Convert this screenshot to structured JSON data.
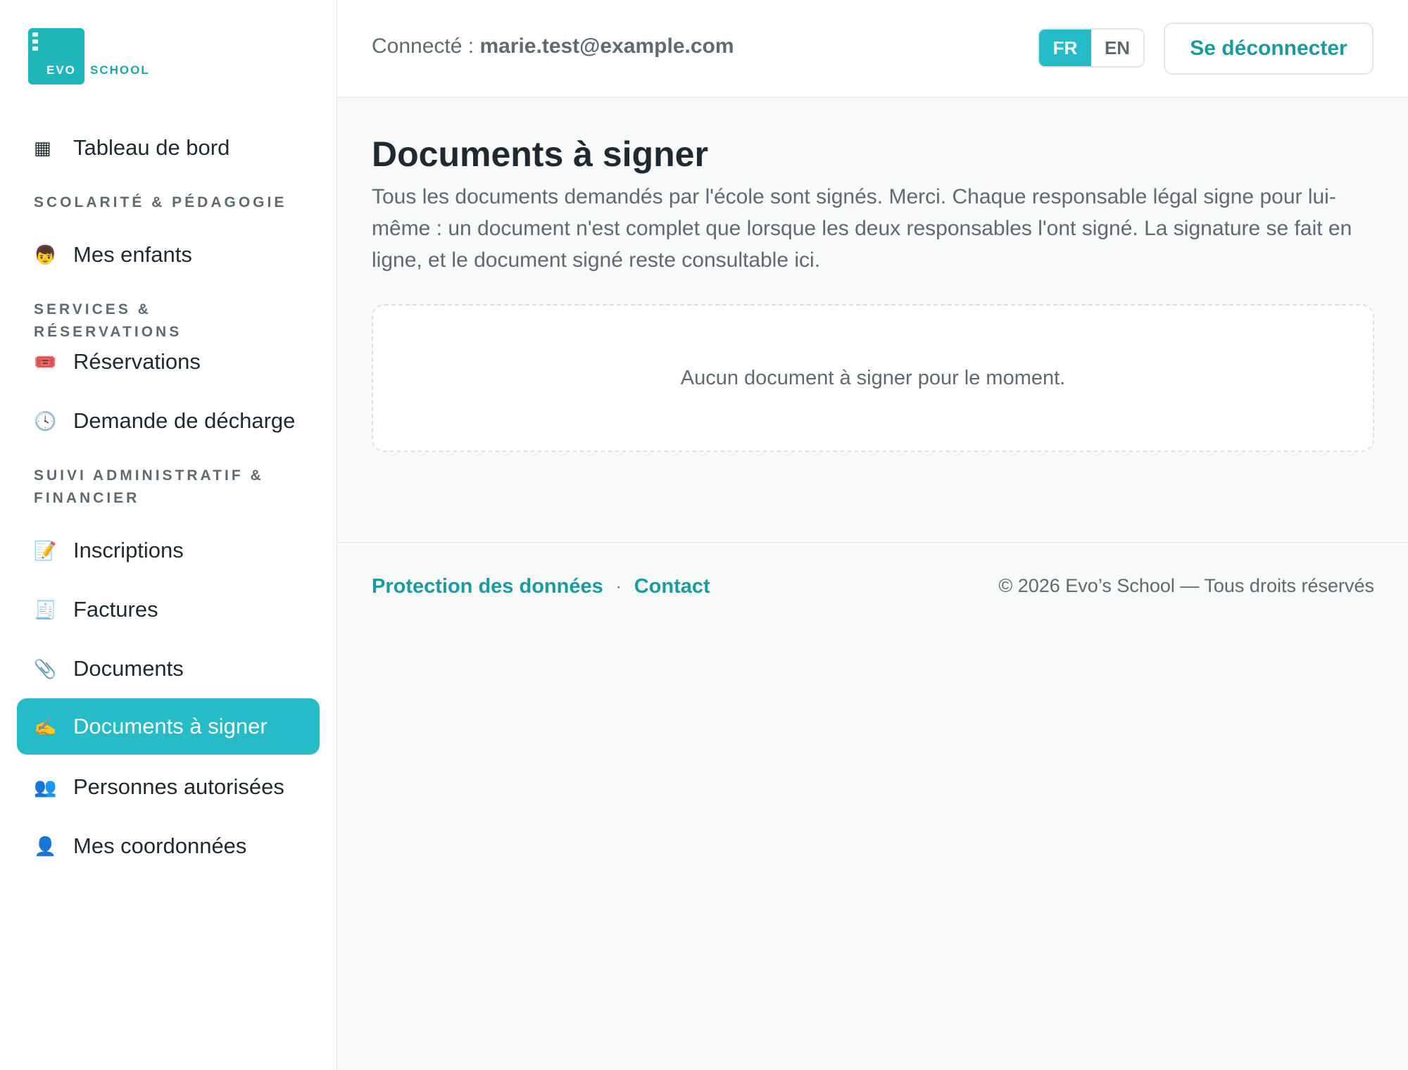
{
  "brand": {
    "logo_text_left": "EVO",
    "logo_text_right": "SCHOOL",
    "accent_color": "#26bcc7"
  },
  "sidebar": {
    "dashboard": {
      "icon": "▦",
      "label": "Tableau de bord"
    },
    "section_scolarite": "SCOLARITÉ & PÉDAGOGIE",
    "children": {
      "icon": "👦",
      "label": "Mes enfants"
    },
    "section_services": "SERVICES & RÉSERVATIONS",
    "reservations": {
      "icon": "🎟️",
      "label": "Réservations"
    },
    "decharge": {
      "icon": "🕓",
      "label": "Demande de décharge"
    },
    "section_admin": "SUIVI ADMINISTRATIF & FINANCIER",
    "inscriptions": {
      "icon": "📝",
      "label": "Inscriptions"
    },
    "factures": {
      "icon": "🧾",
      "label": "Factures"
    },
    "documents": {
      "icon": "📎",
      "label": "Documents"
    },
    "documents_sign": {
      "icon": "✍️",
      "label": "Documents à signer"
    },
    "personnes": {
      "icon": "👥",
      "label": "Personnes autorisées"
    },
    "coordonnees": {
      "icon": "👤",
      "label": "Mes coordonnées"
    }
  },
  "header": {
    "connected_prefix": "Connecté : ",
    "user_email": "marie.test@example.com",
    "lang_fr": "FR",
    "lang_en": "EN",
    "active_lang": "FR",
    "logout_label": "Se déconnecter"
  },
  "main": {
    "title": "Documents à signer",
    "description": "Tous les documents demandés par l'école sont signés. Merci. Chaque responsable légal signe pour lui-même : un document n'est complet que lorsque les deux responsables l'ont signé. La signature se fait en ligne, et le document signé reste consultable ici.",
    "empty_message": "Aucun document à signer pour le moment."
  },
  "footer": {
    "privacy_link": "Protection des données",
    "separator": "·",
    "contact_link": "Contact",
    "copyright": "© 2026 Evo’s School — Tous droits réservés"
  }
}
